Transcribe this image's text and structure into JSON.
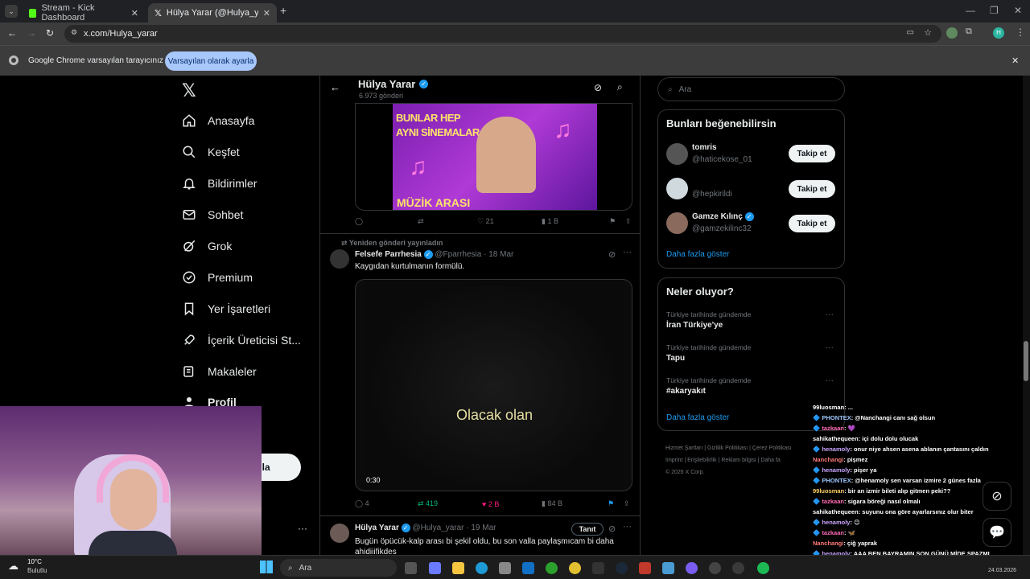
{
  "browser": {
    "tabs": [
      {
        "title": "Stream - Kick Dashboard"
      },
      {
        "title": "Hülya Yarar (@Hulya_yarar) / X"
      }
    ],
    "url": "x.com/Hulya_yarar",
    "infobar_text": "Google Chrome varsayılan tarayıcınız değil",
    "infobar_button": "Varsayılan olarak ayarla"
  },
  "nav": {
    "items": [
      {
        "label": "Anasayfa",
        "icon": "home-icon"
      },
      {
        "label": "Keşfet",
        "icon": "search-icon"
      },
      {
        "label": "Bildirimler",
        "icon": "bell-icon"
      },
      {
        "label": "Sohbet",
        "icon": "mail-icon"
      },
      {
        "label": "Grok",
        "icon": "grok-icon"
      },
      {
        "label": "Premium",
        "icon": "premium-icon"
      },
      {
        "label": "Yer İşaretleri",
        "icon": "bookmark-icon"
      },
      {
        "label": "İçerik Üreticisi St...",
        "icon": "rocket-icon"
      },
      {
        "label": "Makaleler",
        "icon": "article-icon"
      },
      {
        "label": "Profil",
        "icon": "person-icon"
      }
    ],
    "post_button_fragment": "nla",
    "more_dots": "···"
  },
  "header": {
    "name": "Hülya Yarar",
    "posts": "6.973 gönderi"
  },
  "thumb1": {
    "line1": "BUNLAR HEP",
    "line2": "AYNI SİNEMALAR",
    "bottom": "MÜZİK ARASI"
  },
  "post1_actions": {
    "likes": "21",
    "views": "1 B"
  },
  "repost_note": "Yeniden gönderi yayınladın",
  "post2": {
    "author": "Felsefe Parrhesia",
    "handle": "@Fparrhesia",
    "date": "· 18 Mar",
    "text": "Kaygıdan kurtulmanın formülü.",
    "video_caption": "Olacak olan",
    "video_time": "0:30",
    "replies": "4",
    "reposts": "419",
    "likes": "2 B",
    "views": "84 B"
  },
  "post3": {
    "author": "Hülya Yarar",
    "handle": "@Hulya_yarar",
    "date": "· 19 Mar",
    "promote": "Tanıt",
    "text": "Bugün öpücük-kalp arası bi şekil oldu, bu son valla paylaşmıcam bi daha ahidiiifikdes"
  },
  "search": {
    "placeholder": "Ara"
  },
  "suggest": {
    "title": "Bunları beğenebilirsin",
    "users": [
      {
        "name": "tomris",
        "handle": "@haticekose_01",
        "button": "Takip et"
      },
      {
        "name": "",
        "handle": "@hepkirildi",
        "button": "Takip et"
      },
      {
        "name": "Gamze Kılınç",
        "handle": "@gamzekilinc32",
        "button": "Takip et"
      }
    ],
    "more": "Daha fazla göster"
  },
  "trends": {
    "title": "Neler oluyor?",
    "items": [
      {
        "context": "Türkiye tarihinde gündemde",
        "topic": "İran Türkiye'ye"
      },
      {
        "context": "Türkiye tarihinde gündemde",
        "topic": "Tapu"
      },
      {
        "context": "Türkiye tarihinde gündemde",
        "topic": "#akaryakıt"
      }
    ],
    "more": "Daha fazla göster"
  },
  "footer": {
    "links": [
      "Hizmet Şartları",
      "Gizlilik Politikası",
      "Çerez Politikası",
      "Imprint",
      "Erişilebilirlik",
      "Reklam bilgisi",
      "Daha fa"
    ],
    "copyright": "© 2026 X Corp."
  },
  "chat": [
    {
      "user": "99luosman",
      "msg": ": ... "
    },
    {
      "user": "PHONTEX",
      "msg": ": @Nanchangi canı sağ olsun"
    },
    {
      "user": "tazkaan",
      "msg": ": 💜"
    },
    {
      "user": "sahikathequeen",
      "msg": ": içi dolu dolu olucak"
    },
    {
      "user": "henamoly",
      "msg": ": onur niye ahsen asena ablanın çantasını çaldın"
    },
    {
      "user": "Nanchangi",
      "msg": ": pişmez"
    },
    {
      "user": "henamoly",
      "msg": ": pişer ya"
    },
    {
      "user": "PHONTEX",
      "msg": ": @henamoly sen varsan izmire 2 günes fazla"
    },
    {
      "user": "99luosman",
      "msg": ": bir an izmir bileti alıp gitmen peki??"
    },
    {
      "user": "tazkaan",
      "msg": ": sigara böreği nasıl olmalı"
    },
    {
      "user": "sahikathequeen",
      "msg": ": suyunu ona göre ayarlarsınız olur biter"
    },
    {
      "user": "henamoly",
      "msg": ": 😊"
    },
    {
      "user": "tazkaan",
      "msg": ": 🦋"
    },
    {
      "user": "Nanchangi",
      "msg": ": çiğ yaprak"
    },
    {
      "user": "henamoly",
      "msg": ": AAA BEN BAYRAMIN SON GÜNÜ MİDE SPAZMI GEÇİRDİM SHDLANDLANFLANDJA"
    }
  ],
  "taskbar": {
    "weather_temp": "10°C",
    "weather_desc": "Bulutlu",
    "search": "Ara",
    "date": "24.03.2026"
  }
}
